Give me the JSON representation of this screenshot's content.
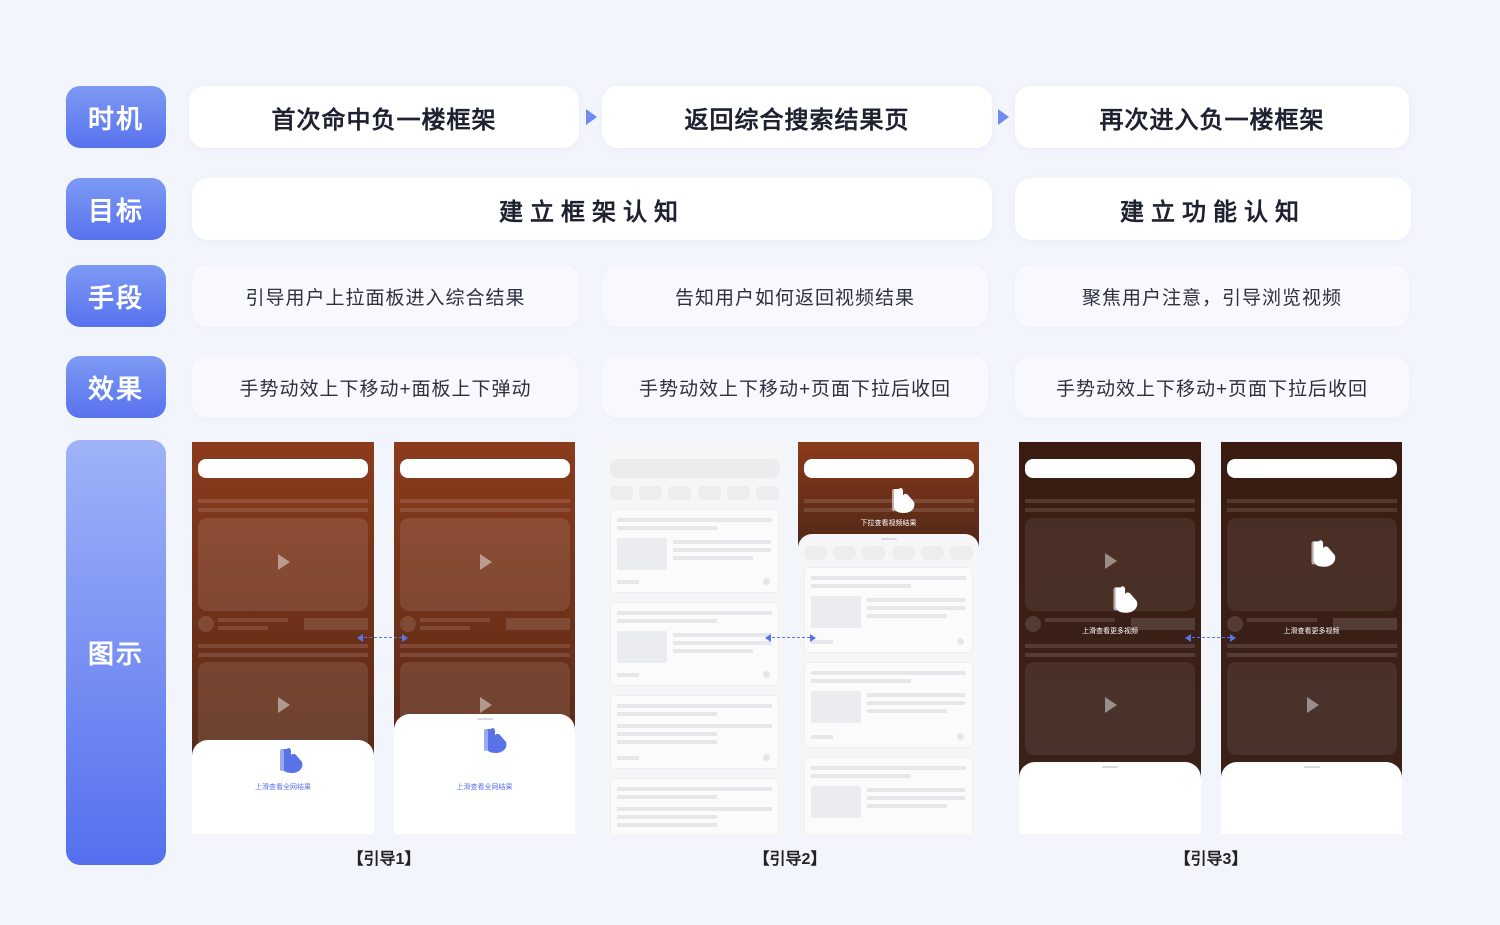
{
  "row_labels": {
    "timing": "时机",
    "goal": "目标",
    "method": "手段",
    "effect": "效果",
    "illustration": "图示"
  },
  "timing": [
    "首次命中负一楼框架",
    "返回综合搜索结果页",
    "再次进入负一楼框架"
  ],
  "goal": [
    "建立框架认知",
    "建立功能认知"
  ],
  "method": [
    "引导用户上拉面板进入综合结果",
    "告知用户如何返回视频结果",
    "聚焦用户注意，引导浏览视频"
  ],
  "effect": [
    "手势动效上下移动+面板上下弹动",
    "手势动效上下移动+页面下拉后收回",
    "手势动效上下移动+页面下拉后收回"
  ],
  "phone_texts": {
    "swipe_up_all": "上滑查看全网结果",
    "pull_down_video": "下拉查看视频结果",
    "swipe_up_more_video": "上滑查看更多视频"
  },
  "captions": [
    "【引导1】",
    "【引导2】",
    "【引导3】"
  ],
  "colors": {
    "accent": "#5872ee",
    "label_gradient_top": "#7d9af4",
    "background": "#f3f5fd",
    "brown_page": "#7a3519",
    "dark_page": "#3a1f15"
  },
  "icons": [
    "arrow-right-icon",
    "play-icon",
    "hand-gesture-icon",
    "double-arrow-icon"
  ]
}
